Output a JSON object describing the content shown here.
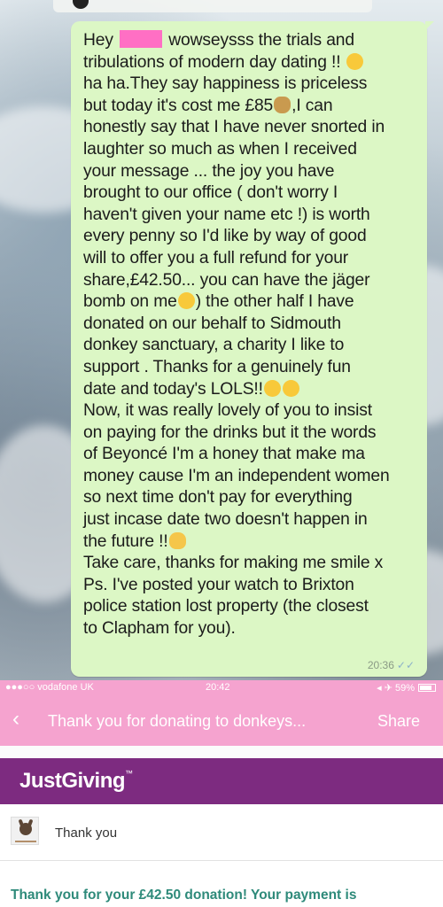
{
  "chat": {
    "lines": [
      "wowseysss the trials and",
      "tribulations of modern day dating !! ",
      "ha ha.They say happiness is priceless",
      "but today it's cost me £85",
      ",I can",
      "honestly say that I have never snorted in",
      "laughter so much as when I received",
      "your message ... the joy you have",
      "brought to our office ( don't worry I",
      "haven't given your name etc !) is worth",
      "every penny so I'd like by way of good",
      "will to offer you a full refund for your",
      "share,£42.50... you can have the jäger",
      "bomb on me",
      ") the other half I have",
      "donated on our behalf to Sidmouth",
      "donkey sanctuary, a charity I like to",
      "support . Thanks for a genuinely fun",
      "date and today's LOLS!!",
      "Now, it was really lovely of you to insist",
      "on paying for the drinks but it the words",
      "of Beyoncé I'm a honey that make ma",
      "money cause I'm an independent women",
      "so next time don't  pay for everything",
      "just incase date two doesn't happen in",
      "the future !!",
      "Take care, thanks for making me smile x",
      "Ps. I've posted your watch to Brixton",
      "police station lost property (the closest",
      "to Clapham for you)."
    ],
    "greeting": "Hey",
    "timestamp": "20:36",
    "ticks": "✓✓"
  },
  "status_bar": {
    "carrier": "●●●○○ vodafone UK",
    "time": "20:42",
    "right": "◂ ✈ 59%"
  },
  "nav": {
    "back": "‹",
    "title": "Thank you for donating to donkeys...",
    "share": "Share"
  },
  "justgiving": {
    "logo": "JustGiving",
    "logo_mark": "™"
  },
  "thank_row": {
    "label": "Thank you"
  },
  "confirmation": {
    "text": "Thank you for your £42.50 donation! Your payment is"
  },
  "colors": {
    "bubble": "#dcf7c5",
    "pink_bar": "#f5a3cf",
    "justgiving_purple": "#7d2b80",
    "confirmation_teal": "#2e8a7a",
    "redaction": "#ff6fc4"
  },
  "icons": [
    "redaction-block",
    "thinking-emoji",
    "money-bag-emoji",
    "grimace-emoji",
    "laughing-emoji",
    "ok-hand-emoji",
    "back-chevron-icon",
    "donkey-logo-icon",
    "battery-icon"
  ]
}
